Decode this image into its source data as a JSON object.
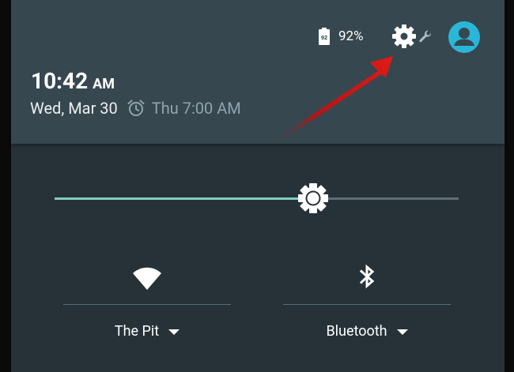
{
  "status": {
    "battery_level": "92",
    "battery_percent": "92%"
  },
  "clock": {
    "time": "10:42",
    "ampm": "AM",
    "date": "Wed, Mar 30",
    "alarm": "Thu 7:00 AM"
  },
  "brightness": {
    "level_fraction": 0.64
  },
  "tiles": {
    "wifi": {
      "label": "The Pit",
      "icon": "wifi-icon"
    },
    "bluetooth": {
      "label": "Bluetooth",
      "icon": "bluetooth-icon"
    }
  },
  "icons": {
    "settings": "settings-gear-icon",
    "wrench": "wrench-icon",
    "avatar": "user-avatar-icon",
    "alarm": "alarm-clock-icon",
    "brightness": "brightness-icon"
  },
  "colors": {
    "header_bg": "#37474f",
    "panel_bg": "#263238",
    "accent": "#80cbc4",
    "avatar": "#29b6d8",
    "annotation_arrow": "#d01818"
  }
}
